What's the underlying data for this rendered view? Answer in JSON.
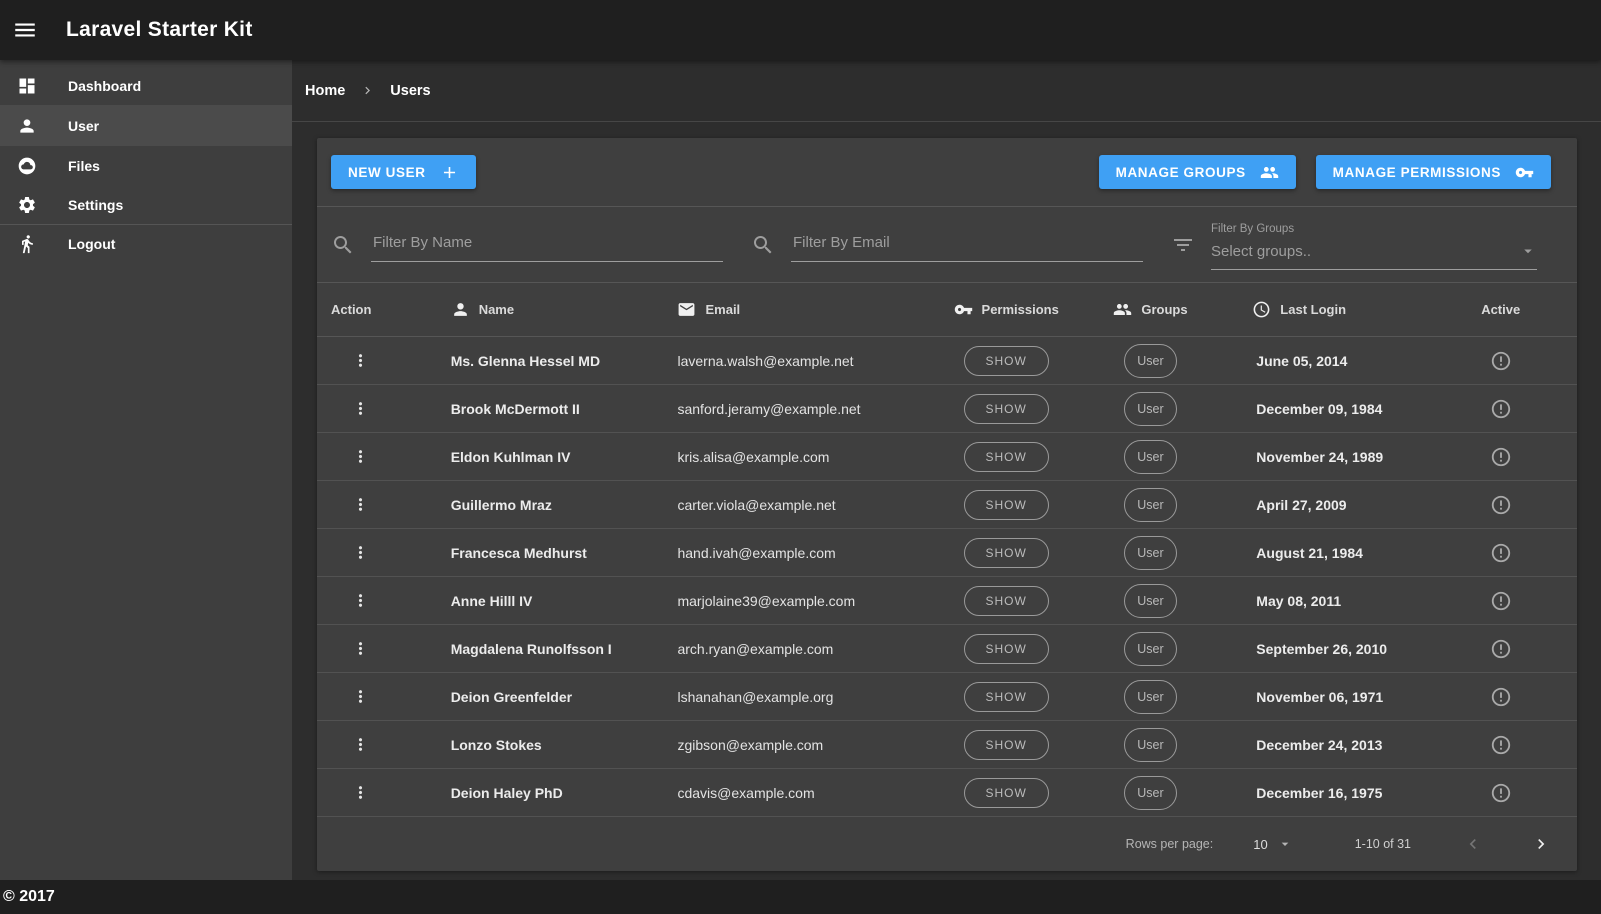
{
  "app": {
    "title": "Laravel Starter Kit",
    "copyright": "© 2017"
  },
  "colors": {
    "accent_blue": "#3fa0f4",
    "topbar_bg": "#1f1f1f",
    "sidebar_bg": "#3e3e3e",
    "card_bg": "#3f3f3f"
  },
  "sidebar": {
    "items": [
      {
        "label": "Dashboard",
        "icon": "dashboard-icon",
        "selected": false
      },
      {
        "label": "User",
        "icon": "person-icon",
        "selected": true
      },
      {
        "label": "Files",
        "icon": "cloud-circle-icon",
        "selected": false
      },
      {
        "label": "Settings",
        "icon": "gear-icon",
        "selected": false
      },
      {
        "label": "Logout",
        "icon": "walk-icon",
        "selected": false
      }
    ]
  },
  "breadcrumb": {
    "home": "Home",
    "current": "Users"
  },
  "toolbar": {
    "new_user_label": "NEW USER",
    "manage_groups_label": "MANAGE GROUPS",
    "manage_permissions_label": "MANAGE PERMISSIONS"
  },
  "filters": {
    "name_placeholder": "Filter By Name",
    "email_placeholder": "Filter By Email",
    "groups_label": "Filter By Groups",
    "groups_placeholder": "Select groups.."
  },
  "table": {
    "headers": {
      "action": "Action",
      "name": "Name",
      "email": "Email",
      "permissions": "Permissions",
      "groups": "Groups",
      "last_login": "Last Login",
      "active": "Active"
    },
    "rows": [
      {
        "name": "Ms. Glenna Hessel MD",
        "email": "laverna.walsh@example.net",
        "permissions": "SHOW",
        "group": "User",
        "last_login": "June 05, 2014"
      },
      {
        "name": "Brook McDermott II",
        "email": "sanford.jeramy@example.net",
        "permissions": "SHOW",
        "group": "User",
        "last_login": "December 09, 1984"
      },
      {
        "name": "Eldon Kuhlman IV",
        "email": "kris.alisa@example.com",
        "permissions": "SHOW",
        "group": "User",
        "last_login": "November 24, 1989"
      },
      {
        "name": "Guillermo Mraz",
        "email": "carter.viola@example.net",
        "permissions": "SHOW",
        "group": "User",
        "last_login": "April 27, 2009"
      },
      {
        "name": "Francesca Medhurst",
        "email": "hand.ivah@example.com",
        "permissions": "SHOW",
        "group": "User",
        "last_login": "August 21, 1984"
      },
      {
        "name": "Anne Hilll IV",
        "email": "marjolaine39@example.com",
        "permissions": "SHOW",
        "group": "User",
        "last_login": "May 08, 2011"
      },
      {
        "name": "Magdalena Runolfsson I",
        "email": "arch.ryan@example.com",
        "permissions": "SHOW",
        "group": "User",
        "last_login": "September 26, 2010"
      },
      {
        "name": "Deion Greenfelder",
        "email": "lshanahan@example.org",
        "permissions": "SHOW",
        "group": "User",
        "last_login": "November 06, 1971"
      },
      {
        "name": "Lonzo Stokes",
        "email": "zgibson@example.com",
        "permissions": "SHOW",
        "group": "User",
        "last_login": "December 24, 2013"
      },
      {
        "name": "Deion Haley PhD",
        "email": "cdavis@example.com",
        "permissions": "SHOW",
        "group": "User",
        "last_login": "December 16, 1975"
      }
    ]
  },
  "pagination": {
    "rows_per_page_label": "Rows per page:",
    "rows_per_page_value": "10",
    "range": "1-10 of 31"
  }
}
